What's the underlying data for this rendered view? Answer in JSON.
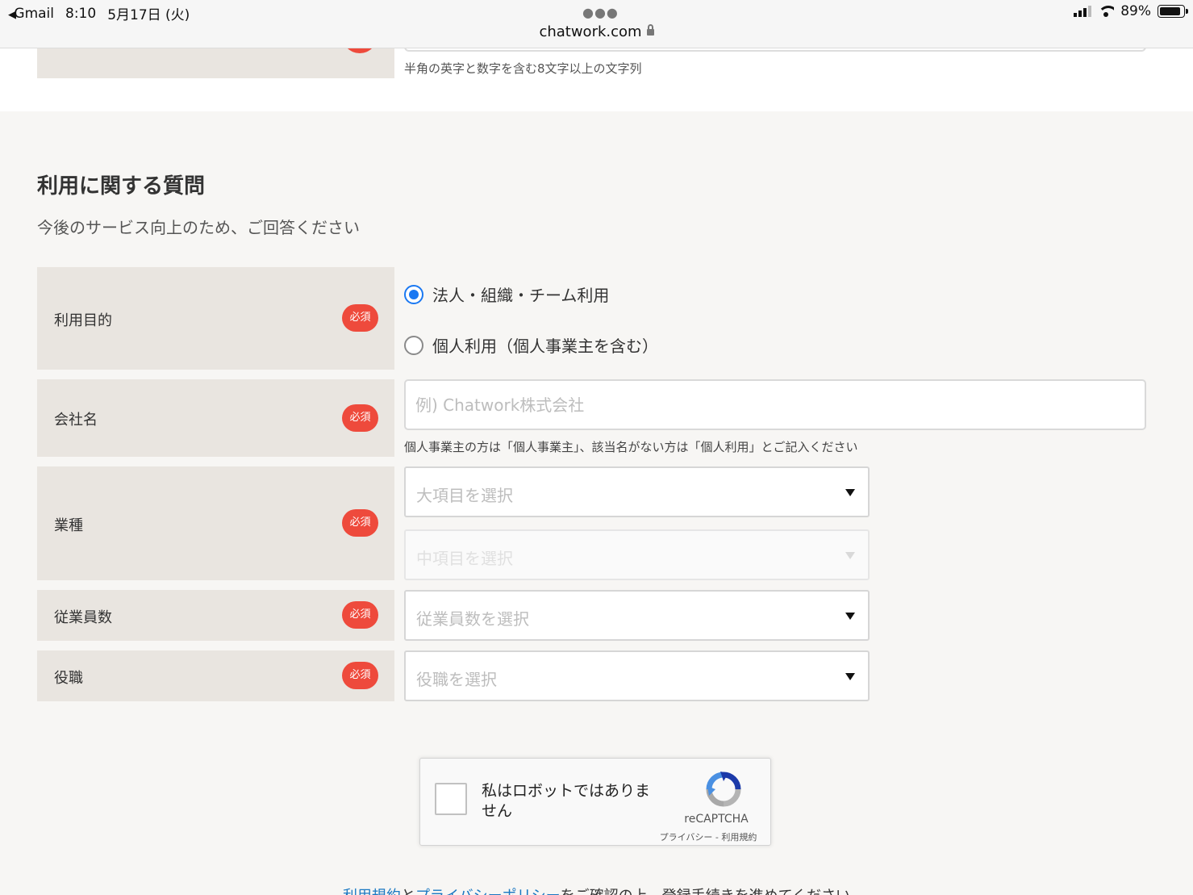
{
  "status_bar": {
    "back_app": "Gmail",
    "time": "8:10",
    "date": "5月17日 (火)",
    "url": "chatwork.com",
    "battery": "89%",
    "battery_level": 0.89
  },
  "password_hint": "半角の英字と数字を含む8文字以上の文字列",
  "section": {
    "title": "利用に関する質問",
    "subtitle": "今後のサービス向上のため、ご回答ください"
  },
  "required_badge": "必須",
  "fields": {
    "purpose": {
      "label": "利用目的",
      "options": [
        "法人・組織・チーム利用",
        "個人利用（個人事業主を含む）"
      ],
      "selected_index": 0
    },
    "company": {
      "label": "会社名",
      "placeholder": "例) Chatwork株式会社",
      "hint": "個人事業主の方は「個人事業主」、該当名がない方は「個人利用」とご記入ください"
    },
    "industry": {
      "label": "業種",
      "major_placeholder": "大項目を選択",
      "minor_placeholder": "中項目を選択"
    },
    "employees": {
      "label": "従業員数",
      "placeholder": "従業員数を選択"
    },
    "position": {
      "label": "役職",
      "placeholder": "役職を選択"
    }
  },
  "recaptcha": {
    "label": "私はロボットではありません",
    "brand": "reCAPTCHA",
    "privacy": "プライバシー",
    "separator": " - ",
    "terms": "利用規約"
  },
  "footer": {
    "terms_link": "利用規約",
    "and": "と",
    "privacy_link": "プライバシーポリシー",
    "rest": "をご確認の上、登録手続きを進めてください"
  }
}
